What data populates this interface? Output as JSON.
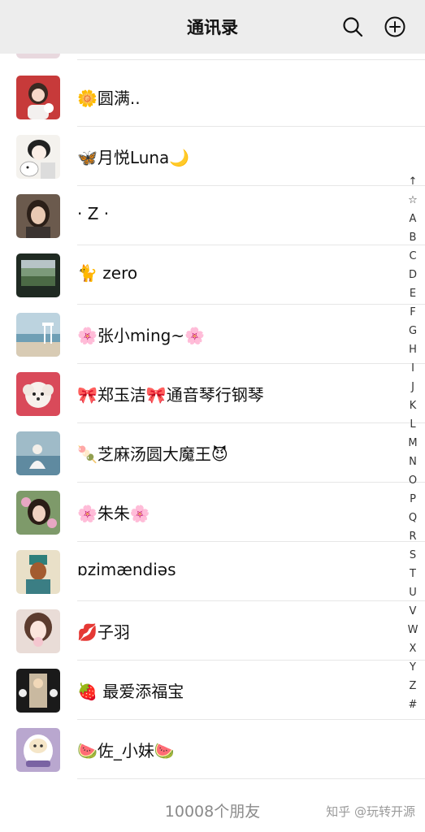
{
  "header": {
    "title": "通讯录",
    "search_icon": "search-icon",
    "add_icon": "add-circle-icon"
  },
  "contacts": [
    {
      "name": "🌼圆满..",
      "avatar": "girl-cartoon-red-avatar"
    },
    {
      "name": "🦋月悦Luna🌙",
      "avatar": "girl-sketch-dog-avatar"
    },
    {
      "name": "· Z ·",
      "avatar": "woman-photo-avatar"
    },
    {
      "name": "🐈 zero",
      "avatar": "landscape-photo-avatar"
    },
    {
      "name": "🌸张小ming~🌸",
      "avatar": "beach-photo-avatar"
    },
    {
      "name": "🎀郑玉洁🎀通音琴行钢琴",
      "avatar": "poodle-photo-avatar"
    },
    {
      "name": "🍡芝麻汤圆大魔王😈",
      "avatar": "sea-person-avatar"
    },
    {
      "name": "🌸朱朱🌸",
      "avatar": "woman-flowers-avatar"
    },
    {
      "name": "ɒzimændiəs",
      "avatar": "statue-avatar"
    },
    {
      "name": "💋子羽",
      "avatar": "girl-filter-avatar"
    },
    {
      "name": "🍓 最爱添福宝",
      "avatar": "collage-avatar"
    },
    {
      "name": "🍉佐_小妹🍉",
      "avatar": "daruma-cartoon-avatar"
    }
  ],
  "index_bar": [
    "↑",
    "☆",
    "A",
    "B",
    "C",
    "D",
    "E",
    "F",
    "G",
    "H",
    "I",
    "J",
    "K",
    "L",
    "M",
    "N",
    "O",
    "P",
    "Q",
    "R",
    "S",
    "T",
    "U",
    "V",
    "W",
    "X",
    "Y",
    "Z",
    "#"
  ],
  "footer": {
    "count_text": "10008个朋友"
  },
  "watermark": "知乎 @玩转开源",
  "colors": {
    "header_bg": "#ededed",
    "separator": "#e6e6e6",
    "footer_text": "#8a8a8a"
  }
}
